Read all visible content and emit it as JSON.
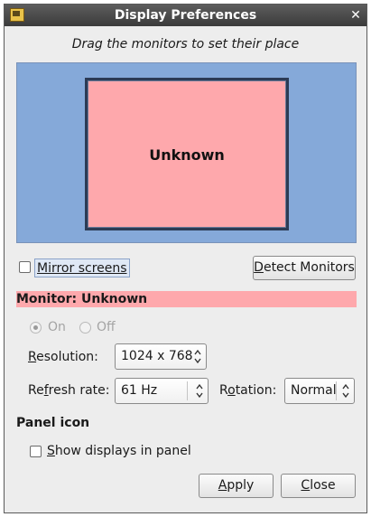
{
  "window": {
    "title": "Display Preferences",
    "subtitle": "Drag the monitors to set their place"
  },
  "monitor_canvas": {
    "monitor_label": "Unknown"
  },
  "mirror": {
    "label": "Mirror screens",
    "checked": false
  },
  "detect_button": {
    "prefix": "D",
    "rest": "etect Monitors"
  },
  "monitor_header": "Monitor: Unknown",
  "power": {
    "on_label": "On",
    "off_label": "Off",
    "selected": "On"
  },
  "resolution": {
    "label_prefix": "R",
    "label_rest": "esolution:",
    "value": "1024 x 768"
  },
  "refresh": {
    "label_prefix": "Re",
    "label_u": "f",
    "label_rest": "resh rate:",
    "value": "61 Hz"
  },
  "rotation": {
    "label_prefix": "R",
    "label_u": "o",
    "label_rest": "tation:",
    "value": "Normal"
  },
  "panel": {
    "section_title": "Panel icon",
    "show_label_u": "S",
    "show_label_rest": "how displays in panel",
    "checked": false
  },
  "buttons": {
    "apply_u": "A",
    "apply_rest": "pply",
    "close_u": "C",
    "close_rest": "lose"
  },
  "colors": {
    "canvas_bg": "#85a9d9",
    "monitor_fill": "#fea8ac",
    "header_fill": "#fea8ac"
  }
}
